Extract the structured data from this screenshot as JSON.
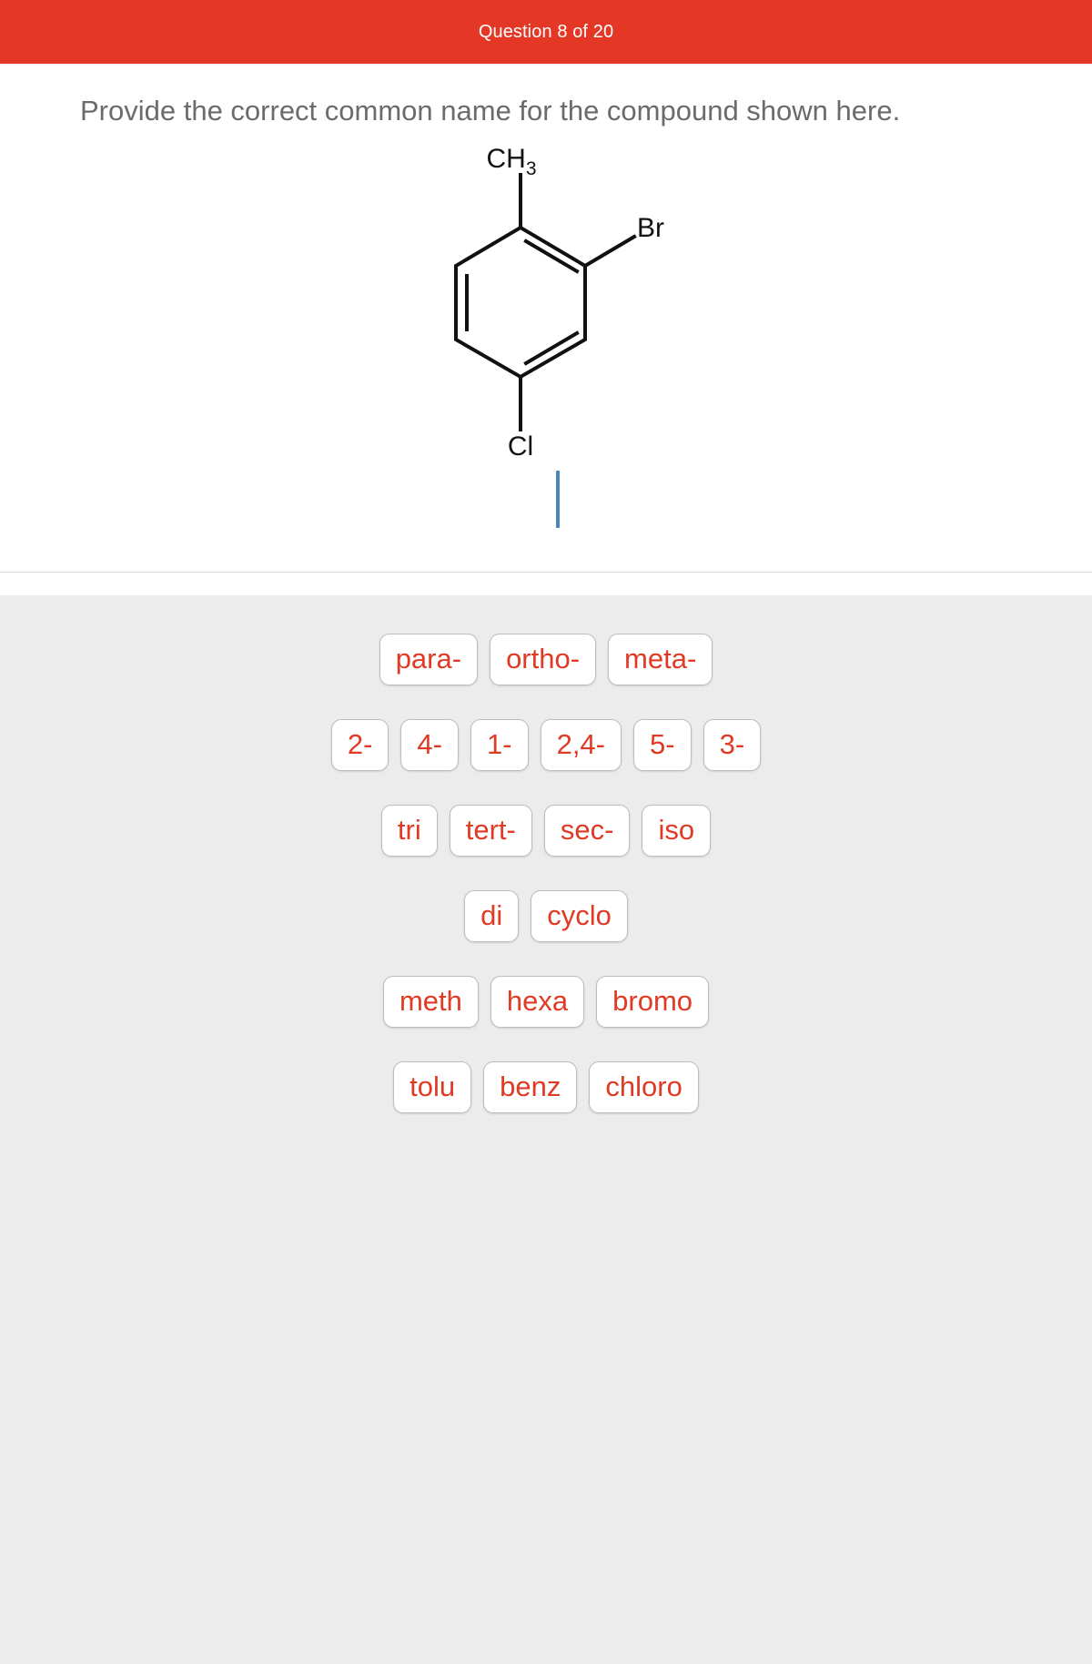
{
  "header": {
    "title": "Question 8 of 20",
    "background_color": "#E43725",
    "text_color": "#FFFFFF"
  },
  "question": {
    "prompt": "Provide the correct common name for the compound shown here.",
    "text_color": "#6B6B6B"
  },
  "molecule": {
    "name": "benzene-ring-structure",
    "description": "Substituted benzene ring",
    "labels": {
      "methyl": "CH",
      "methyl_subscript": "3",
      "bromine": "Br",
      "chlorine": "Cl"
    },
    "substituents": [
      {
        "label": "CH3",
        "position": "top"
      },
      {
        "label": "Br",
        "position": "upper-right"
      },
      {
        "label": "Cl",
        "position": "bottom"
      }
    ],
    "bond_color": "#111111"
  },
  "answer_input": {
    "value": "",
    "caret_color": "#4A86B8",
    "caret_visible": true
  },
  "chip_tray": {
    "background_color": "#ECECEC",
    "chip_text_color": "#E03A24",
    "chip_background_color": "#FFFFFF",
    "rows": [
      {
        "chips": [
          "para-",
          "ortho-",
          "meta-"
        ]
      },
      {
        "chips": [
          "2-",
          "4-",
          "1-",
          "2,4-",
          "5-",
          "3-"
        ]
      },
      {
        "chips": [
          "tri",
          "tert-",
          "sec-",
          "iso"
        ]
      },
      {
        "chips": [
          "di",
          "cyclo"
        ]
      },
      {
        "chips": [
          "meth",
          "hexa",
          "bromo"
        ]
      },
      {
        "chips": [
          "tolu",
          "benz",
          "chloro"
        ]
      }
    ]
  }
}
